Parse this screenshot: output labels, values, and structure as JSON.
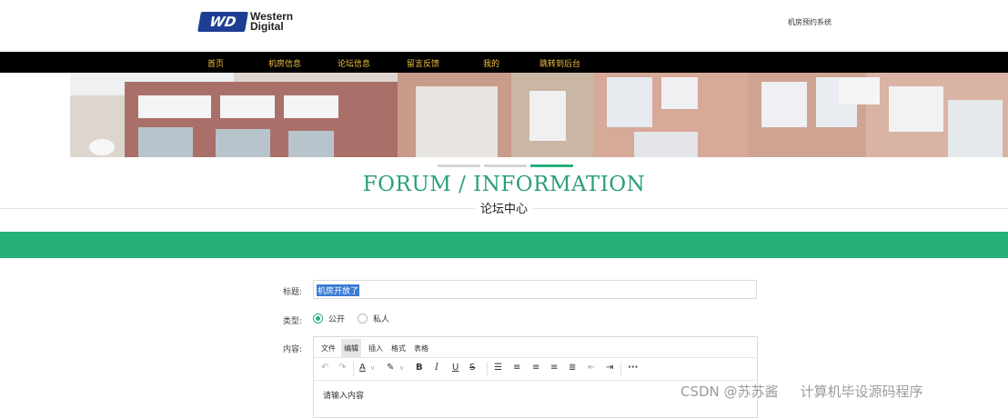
{
  "header": {
    "logo_mark": "WD",
    "logo_line1": "Western",
    "logo_line2": "Digital",
    "site_name": "机房预约系统"
  },
  "nav": {
    "items": [
      "首页",
      "机房信息",
      "论坛信息",
      "留言反馈",
      "我的",
      "跳转到后台"
    ]
  },
  "section": {
    "title": "FORUM / INFORMATION",
    "subtitle": "论坛中心"
  },
  "form": {
    "title_label": "标题:",
    "title_value": "机房开放了",
    "type_label": "类型:",
    "type_options": [
      "公开",
      "私人"
    ],
    "type_selected": "公开",
    "content_label": "内容:",
    "editor": {
      "menu": [
        "文件",
        "编辑",
        "插入",
        "格式",
        "表格"
      ],
      "active_menu": "编辑",
      "toolbar_icons": [
        "undo-icon",
        "redo-icon",
        "text-color-icon",
        "highlight-icon",
        "bold-icon",
        "italic-icon",
        "underline-icon",
        "strikethrough-icon",
        "line-height-icon",
        "align-left-icon",
        "align-center-icon",
        "align-right-icon",
        "align-justify-icon",
        "outdent-icon",
        "indent-icon",
        "more-icon"
      ],
      "placeholder": "请输入内容"
    }
  },
  "watermark": {
    "left": "CSDN @苏苏酱",
    "right": "计算机毕设源码程序"
  },
  "colors": {
    "accent": "#26b07a",
    "nav_bg": "#000000",
    "nav_text": "#f0c040",
    "logo_blue": "#1d3e93"
  }
}
